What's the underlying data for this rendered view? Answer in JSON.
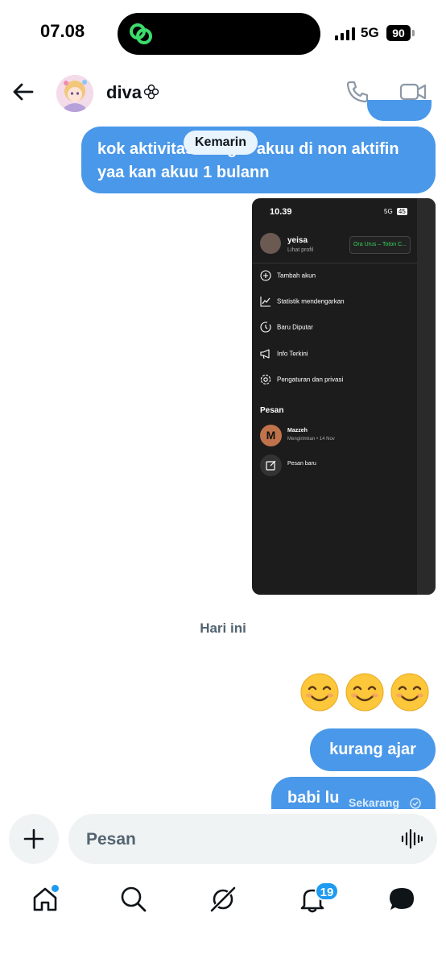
{
  "status_bar": {
    "time": "07.08",
    "network": "5G",
    "battery": "90"
  },
  "header": {
    "name": "diva",
    "back_icon": "arrow-left-icon",
    "call_icon": "phone-icon",
    "video_icon": "video-camera-icon"
  },
  "messages": {
    "message_1": "kok aktivitas dengar akuu di non aktifin yaa kan akuu 1 bulann",
    "date_label_1": "Kemarin",
    "date_label_2": "Hari ini",
    "emoji_count": 3,
    "message_2": "kurang ajar",
    "message_3": "babi lu",
    "message_3_time": "Sekarang"
  },
  "attachment": {
    "time": "10.39",
    "network": "5G",
    "battery": "45",
    "user": "yeisa",
    "subtitle": "Lihat profil",
    "now_playing": "Ora Urus – Toton C...",
    "menu": [
      {
        "label": "Tambah akun",
        "icon": "plus-circle-icon"
      },
      {
        "label": "Statistik mendengarkan",
        "icon": "chart-line-icon"
      },
      {
        "label": "Baru Diputar",
        "icon": "history-icon"
      },
      {
        "label": "Info Terkini",
        "icon": "megaphone-icon"
      },
      {
        "label": "Pengaturan dan privasi",
        "icon": "settings-icon"
      }
    ],
    "section": "Pesan",
    "conversation": {
      "initial": "M",
      "name": "Mazzeh",
      "sub": "Mengirimkan • 14 Nov"
    },
    "new_message": "Pesan baru"
  },
  "composer": {
    "placeholder": "Pesan"
  },
  "nav": {
    "notifications_badge": "19"
  },
  "colors": {
    "bubble": "#4a98e9",
    "accent": "#1d9bf0",
    "muted": "#536471",
    "spotify_green": "#36d45c"
  }
}
